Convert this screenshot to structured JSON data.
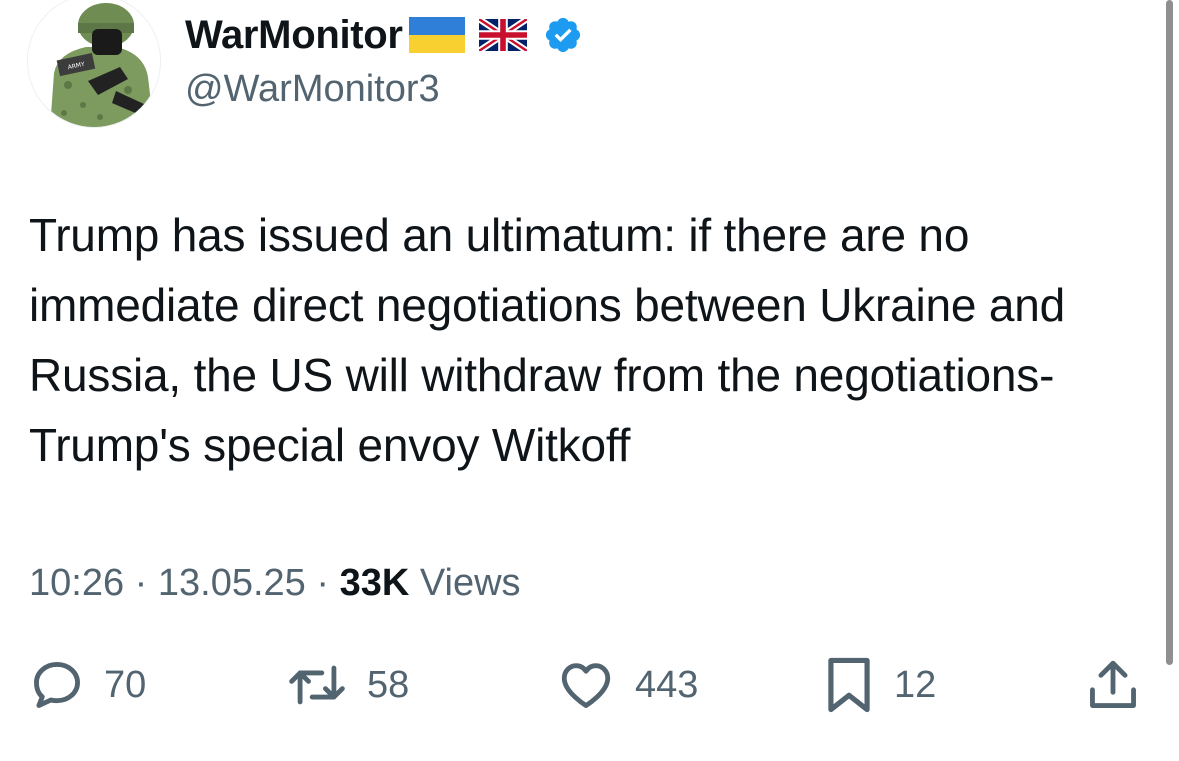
{
  "author": {
    "display_name": "WarMonitor",
    "handle": "@WarMonitor3",
    "flags": [
      "ukraine-flag",
      "uk-flag"
    ],
    "verified": true
  },
  "tweet": {
    "text": "Trump has issued an ultimatum: if there are no immediate direct negotiations between Ukraine and Russia, the US will withdraw from the negotiations-Trump's special envoy Witkoff"
  },
  "meta": {
    "time": "10:26",
    "separator": "·",
    "date": "13.05.25",
    "views_count": "33K",
    "views_label": "Views"
  },
  "actions": {
    "replies": "70",
    "reposts": "58",
    "likes": "443",
    "bookmarks": "12"
  },
  "colors": {
    "text_primary": "#0f1419",
    "text_secondary": "#536471",
    "verified_blue": "#1d9bf0"
  }
}
